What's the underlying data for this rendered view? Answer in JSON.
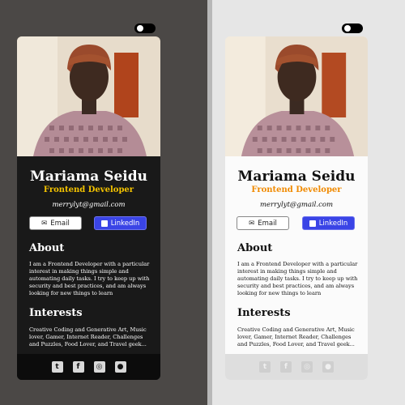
{
  "profile": {
    "name": "Mariama Seidu",
    "title": "Frontend Developer",
    "email": "merrylyt@gmail.com",
    "email_button": "Email",
    "linkedin_button": "LinkedIn",
    "about_heading": "About",
    "about_text": "I am a Frontend Developer with a particular interest in making things simple and automating daily tasks. I try to keep up with security and best practices, and am always looking for new things to learn",
    "interests_heading": "Interests",
    "interests_text": "Creative Coding and Generative Art, Music lover, Gamer, Internet Reader, Challenges and Puzzles, Food Lover, and Travel geek...",
    "social_icons": [
      "twitter-icon",
      "facebook-icon",
      "instagram-icon",
      "github-icon"
    ]
  },
  "themes": {
    "dark": {
      "card_bg": "#191919",
      "accent": "#f4c300"
    },
    "light": {
      "card_bg": "#fbfbfb",
      "accent": "#f08a00"
    }
  },
  "colors": {
    "linkedin": "#3a44e6"
  }
}
